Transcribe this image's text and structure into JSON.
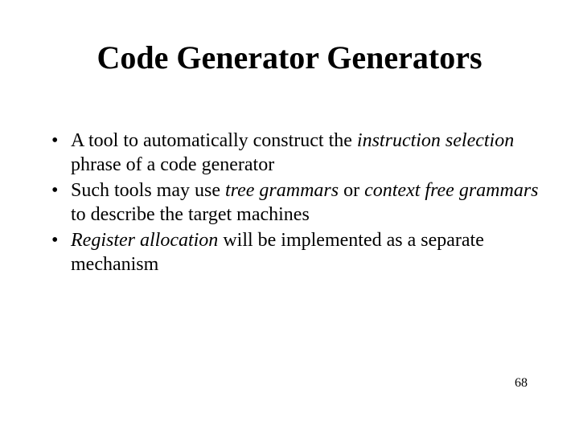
{
  "slide": {
    "title": "Code Generator Generators",
    "bullets": [
      {
        "pre": "A tool to automatically construct the ",
        "em1": "instruction selection",
        "post1": " phrase of a code generator"
      },
      {
        "pre": "Such tools may use ",
        "em1": "tree grammars",
        "mid": " or ",
        "em2": "context free grammars",
        "post1": " to describe the target machines"
      },
      {
        "em1": "Register allocation",
        "post1": " will be implemented as a separate mechanism"
      }
    ],
    "page_number": "68"
  }
}
